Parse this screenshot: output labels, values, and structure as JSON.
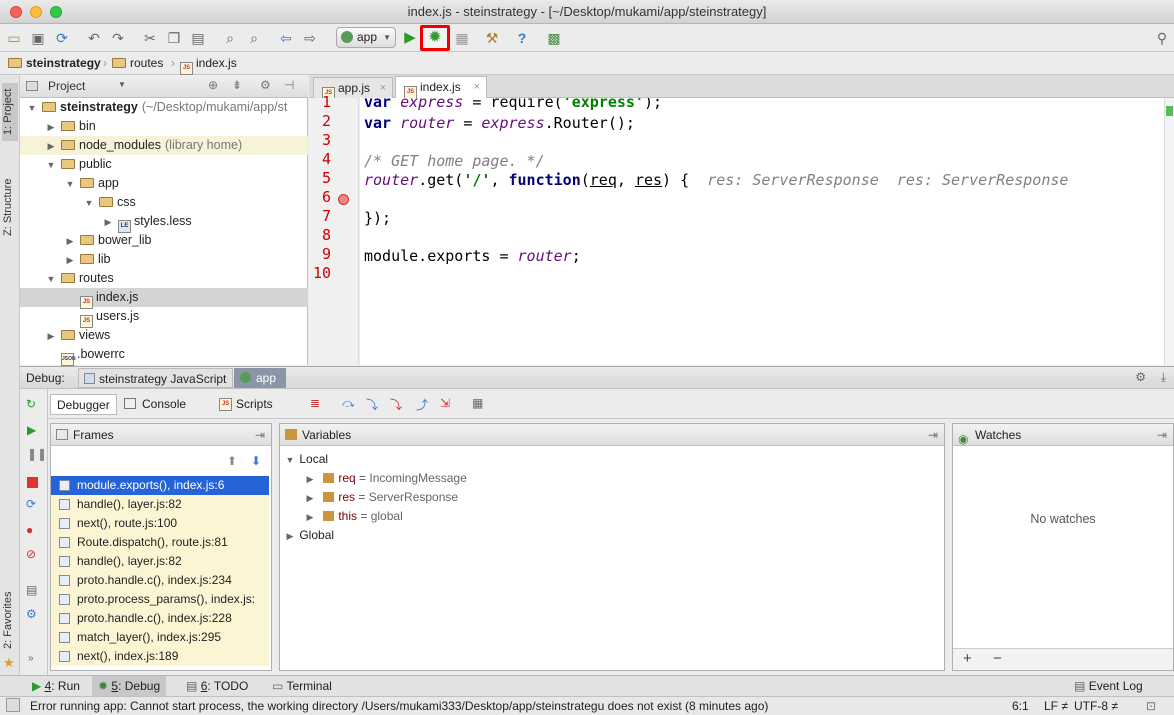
{
  "window": {
    "title": "index.js - steinstrategy - [~/Desktop/mukami/app/steinstrategy]"
  },
  "toolbar": {
    "run_config": "app"
  },
  "breadcrumb": [
    "steinstrategy",
    "routes",
    "index.js"
  ],
  "side_tabs": {
    "project": "1: Project",
    "structure": "Z: Structure",
    "favorites": "2: Favorites"
  },
  "project": {
    "header": "Project",
    "tree": [
      {
        "label": "steinstrategy",
        "suffix": "(~/Desktop/mukami/app/st",
        "type": "folder",
        "level": 0,
        "arrow": "open",
        "bold": true
      },
      {
        "label": "bin",
        "type": "folder",
        "level": 1,
        "arrow": "closed"
      },
      {
        "label": "node_modules",
        "suffix": "(library home)",
        "type": "folder",
        "level": 1,
        "arrow": "closed",
        "lib": true
      },
      {
        "label": "public",
        "type": "folder",
        "level": 1,
        "arrow": "open"
      },
      {
        "label": "app",
        "type": "folder",
        "level": 2,
        "arrow": "open"
      },
      {
        "label": "css",
        "type": "folder",
        "level": 3,
        "arrow": "open"
      },
      {
        "label": "styles.less",
        "type": "file",
        "level": 4,
        "arrow": "closed"
      },
      {
        "label": "bower_lib",
        "type": "folder",
        "level": 2,
        "arrow": "closed"
      },
      {
        "label": "lib",
        "type": "folder",
        "level": 2,
        "arrow": "closed"
      },
      {
        "label": "routes",
        "type": "folder",
        "level": 1,
        "arrow": "open"
      },
      {
        "label": "index.js",
        "type": "js",
        "level": 2,
        "arrow": "none",
        "selected": true
      },
      {
        "label": "users.js",
        "type": "js",
        "level": 2,
        "arrow": "none"
      },
      {
        "label": "views",
        "type": "folder",
        "level": 1,
        "arrow": "closed"
      },
      {
        "label": ".bowerrc",
        "type": "json",
        "level": 1,
        "arrow": "none"
      }
    ]
  },
  "editor": {
    "tabs": [
      "app.js",
      "index.js"
    ],
    "active_tab": 1,
    "line_numbers": [
      "1",
      "2",
      "3",
      "4",
      "5",
      "6",
      "7",
      "8",
      "9",
      "10"
    ],
    "hint": "res: ServerResponse  res: ServerResponse"
  },
  "debug": {
    "label": "Debug:",
    "sessions": [
      "steinstrategy JavaScript",
      "app"
    ],
    "tabs": [
      "Debugger",
      "Console",
      "Scripts"
    ],
    "frames_title": "Frames",
    "frames": [
      "module.exports(), index.js:6",
      "handle(), layer.js:82",
      "next(), route.js:100",
      "Route.dispatch(), route.js:81",
      "handle(), layer.js:82",
      "proto.handle.c(), index.js:234",
      "proto.process_params(), index.js:",
      "proto.handle.c(), index.js:228",
      "match_layer(), index.js:295",
      "next(), index.js:189"
    ],
    "variables_title": "Variables",
    "local_label": "Local",
    "variables": [
      {
        "name": "req",
        "value": "IncomingMessage"
      },
      {
        "name": "res",
        "value": "ServerResponse"
      },
      {
        "name": "this",
        "value": "global"
      }
    ],
    "global_label": "Global",
    "watches_title": "Watches",
    "no_watches": "No watches"
  },
  "bottom_tabs": [
    {
      "num": "4",
      "label": ": Run"
    },
    {
      "num": "5",
      "label": ": Debug"
    },
    {
      "num": "6",
      "label": ": TODO"
    },
    {
      "num": "",
      "label": "Terminal"
    }
  ],
  "event_log": "Event Log",
  "status": {
    "message": "Error running app: Cannot start process, the working directory /Users/mukami333/Desktop/app/steinstrategu does not exist (8 minutes ago)",
    "position": "6:1",
    "line_sep": "LF ≠",
    "encoding": "UTF-8 ≠"
  }
}
